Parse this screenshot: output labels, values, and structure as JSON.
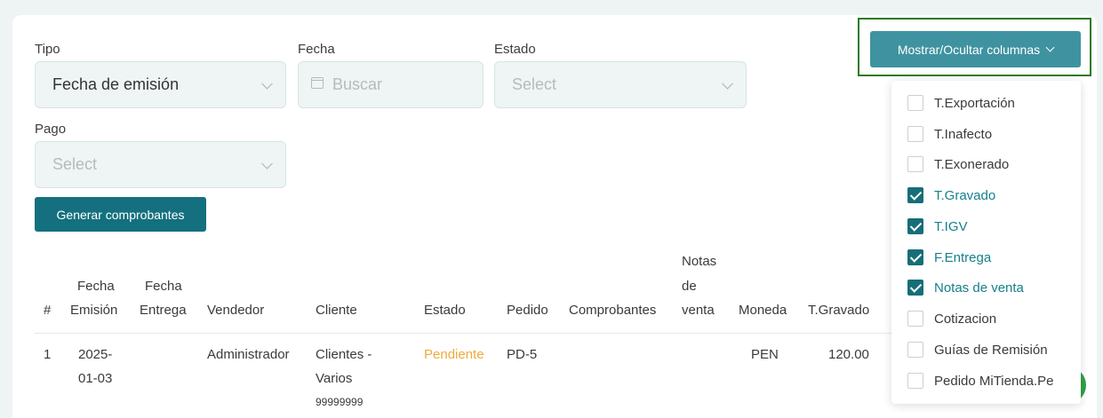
{
  "filters": {
    "tipo": {
      "label": "Tipo",
      "value": "Fecha de emisión"
    },
    "fecha": {
      "label": "Fecha",
      "placeholder": "Buscar"
    },
    "estado": {
      "label": "Estado",
      "placeholder": "Select"
    },
    "pago": {
      "label": "Pago",
      "placeholder": "Select"
    },
    "generate_label": "Generar comprobantes"
  },
  "columns_toggle": {
    "label": "Mostrar/Ocultar columnas",
    "options": [
      {
        "label": "T.Exportación",
        "checked": false
      },
      {
        "label": "T.Inafecto",
        "checked": false
      },
      {
        "label": "T.Exonerado",
        "checked": false
      },
      {
        "label": "T.Gravado",
        "checked": true
      },
      {
        "label": "T.IGV",
        "checked": true
      },
      {
        "label": "F.Entrega",
        "checked": true
      },
      {
        "label": "Notas de venta",
        "checked": true
      },
      {
        "label": "Cotizacion",
        "checked": false
      },
      {
        "label": "Guías de Remisión",
        "checked": false
      },
      {
        "label": "Pedido MiTienda.Pe",
        "checked": false
      }
    ]
  },
  "table": {
    "headers": {
      "num": "#",
      "fecha_emision": [
        "Fecha",
        "Emisión"
      ],
      "fecha_entrega": [
        "Fecha",
        "Entrega"
      ],
      "vendedor": "Vendedor",
      "cliente": "Cliente",
      "estado": "Estado",
      "pedido": "Pedido",
      "comprobantes": "Comprobantes",
      "notas_venta": [
        "Notas",
        "de",
        "venta"
      ],
      "moneda": "Moneda",
      "t_gravado": "T.Gravado"
    },
    "rows": [
      {
        "num": "1",
        "fecha_emision": [
          "2025-",
          "01-03"
        ],
        "fecha_entrega": "",
        "vendedor": "Administrador",
        "cliente": [
          "Clientes -",
          "Varios"
        ],
        "cliente_doc": "99999999",
        "estado": "Pendiente",
        "pedido": "PD-5",
        "comprobantes": "",
        "notas_venta": "",
        "moneda": "PEN",
        "t_gravado": "120.00"
      }
    ]
  },
  "colors": {
    "primary": "#14707e",
    "toggle_button": "#3f93a0",
    "status_pending": "#f0a93b",
    "checked": "#166e78"
  }
}
